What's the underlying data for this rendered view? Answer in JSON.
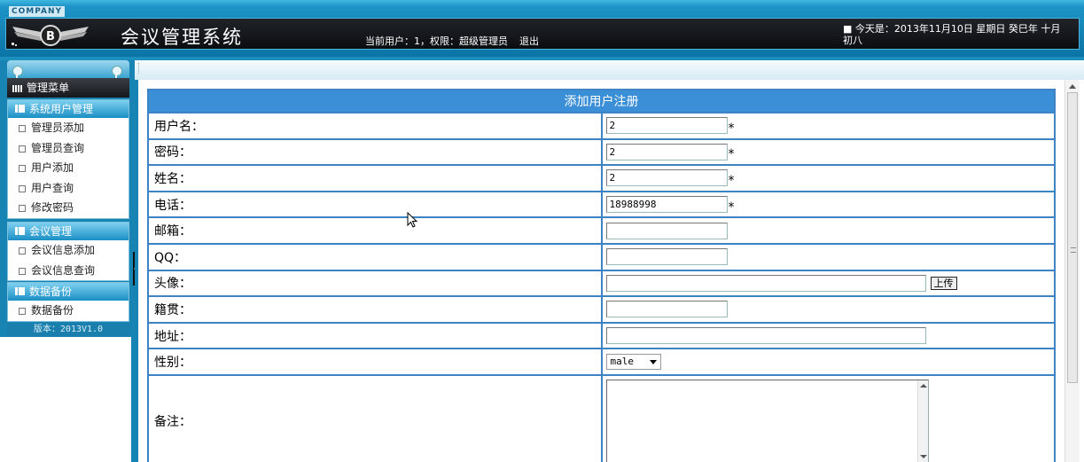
{
  "header": {
    "company": "COMPANY",
    "title": "会议管理系统",
    "user_info": "当前用户：1，权限：超级管理员",
    "logout": "退出",
    "today": "■ 今天是：2013年11月10日 星期日 癸巳年 十月初八"
  },
  "sidebar": {
    "menu_title": "管理菜单",
    "groups": [
      {
        "title": "系统用户管理",
        "items": [
          "管理员添加",
          "管理员查询",
          "用户添加",
          "用户查询",
          "修改密码"
        ]
      },
      {
        "title": "会议管理",
        "items": [
          "会议信息添加",
          "会议信息查询"
        ]
      },
      {
        "title": "数据备份",
        "items": [
          "数据备份"
        ]
      }
    ],
    "version": "版本：2013V1.0"
  },
  "form": {
    "title": "添加用户注册",
    "fields": [
      {
        "label": "用户名：",
        "value": "2",
        "required": "*"
      },
      {
        "label": "密码：",
        "value": "2",
        "required": "*"
      },
      {
        "label": "姓名：",
        "value": "2",
        "required": "*"
      },
      {
        "label": "电话：",
        "value": "18988998",
        "required": "*"
      },
      {
        "label": "邮箱：",
        "value": ""
      },
      {
        "label": "QQ：",
        "value": ""
      },
      {
        "label": "头像：",
        "value": "",
        "button": "上传"
      },
      {
        "label": "籍贯：",
        "value": ""
      },
      {
        "label": "地址：",
        "value": ""
      },
      {
        "label": "性别：",
        "value": "male"
      },
      {
        "label": "备注：",
        "value": ""
      }
    ]
  },
  "icons": [
    "logo-wings-icon",
    "pin-icon",
    "menu-grid-icon",
    "group-icon",
    "item-page-icon",
    "collapse-arrow-icon",
    "scroll-up-icon",
    "scroll-down-icon",
    "dropdown-arrow-icon",
    "mouse-cursor-icon"
  ],
  "colors": {
    "header_dark": "#111418",
    "accent_blue": "#1784b4",
    "table_border": "#3e83c3",
    "table_header": "#3b8fd6"
  }
}
